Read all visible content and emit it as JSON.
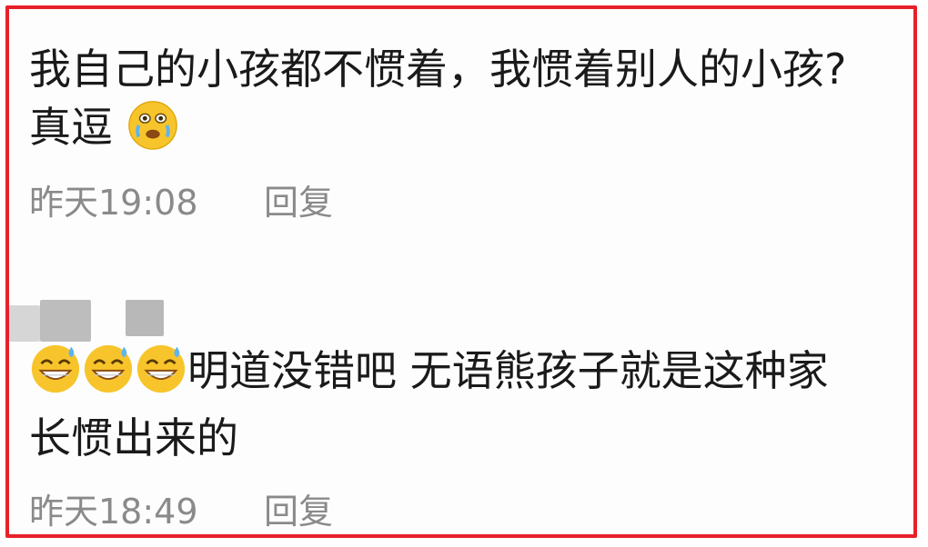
{
  "comments": [
    {
      "line1": "我自己的小孩都不惯着，我惯着别人的小孩?",
      "line2": "真逗",
      "line2_emoji": "joy-tears-icon",
      "time": "昨天19:08",
      "reply": "回复"
    },
    {
      "emojis": [
        "sweat-smile-icon",
        "sweat-smile-icon",
        "sweat-smile-icon"
      ],
      "line1": "明道没错吧 无语熊孩子就是这种家",
      "line2": "长惯出来的",
      "time": "昨天18:49",
      "reply": "回复"
    }
  ],
  "colors": {
    "border": "#e8202a",
    "text": "#1a1a1a",
    "meta": "#8a8a8a",
    "emoji_face": "#f7c52b"
  }
}
